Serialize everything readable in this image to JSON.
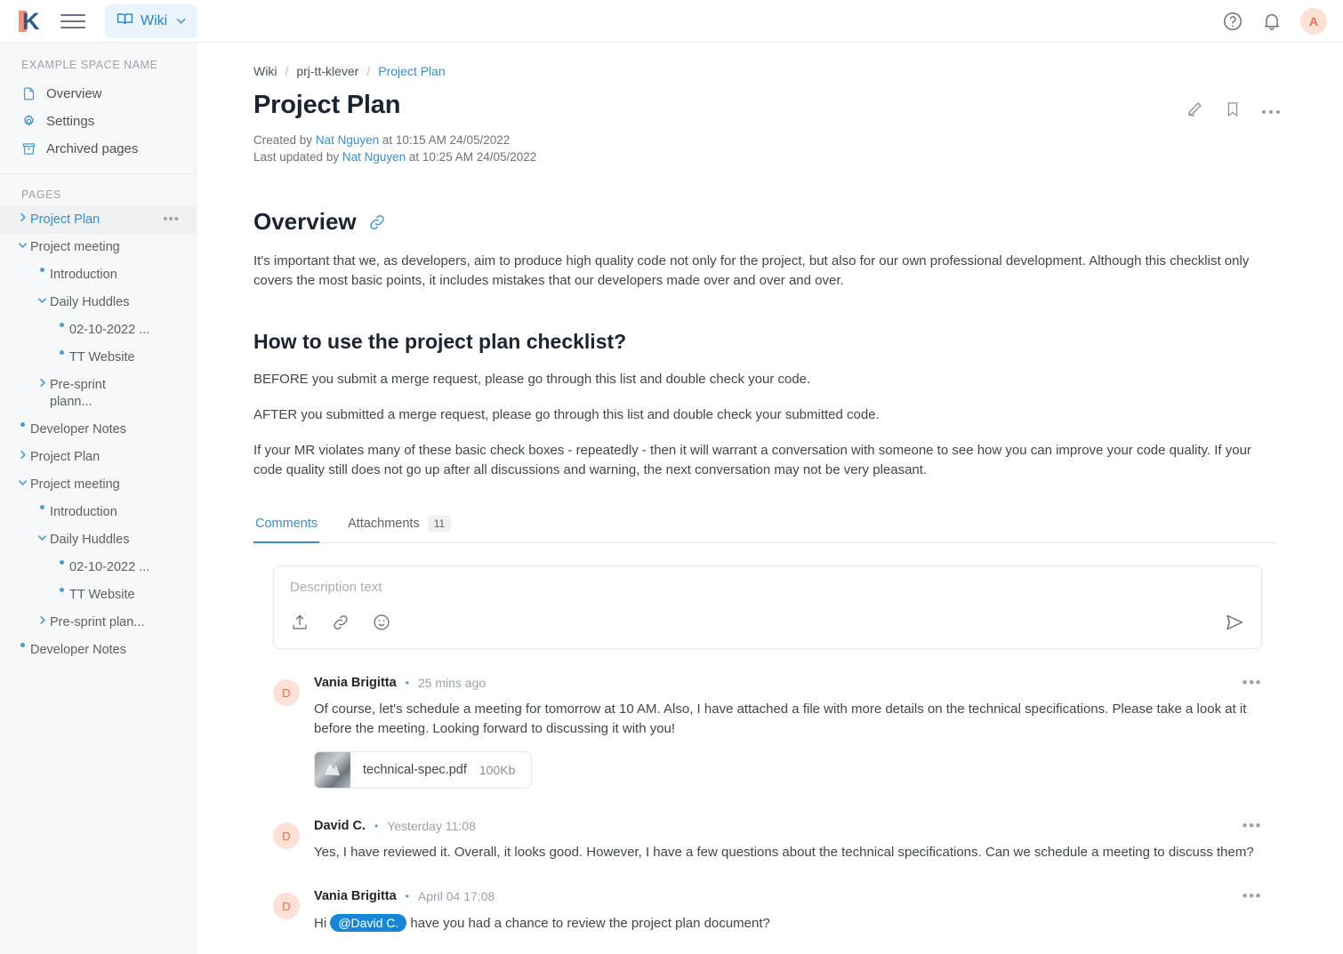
{
  "topbar": {
    "logo_alt": "klever-logo",
    "menu_label": "hamburger-menu",
    "wiki_button": "Wiki",
    "caret": "⌄",
    "help_label": "help",
    "bell_label": "notifications",
    "avatar_initial": "A"
  },
  "sidebar": {
    "space_name": "EXAMPLE SPACE NAME",
    "nav": [
      {
        "label": "Overview",
        "icon": "document-icon"
      },
      {
        "label": "Settings",
        "icon": "gear-icon"
      },
      {
        "label": "Archived pages",
        "icon": "archive-icon"
      }
    ],
    "pages_label": "PAGES",
    "tree": [
      {
        "label": "Project Plan",
        "indent": 0,
        "marker": "chevron-right",
        "active": true,
        "dots": "•••"
      },
      {
        "label": "Project meeting",
        "indent": 0,
        "marker": "chevron-down",
        "active": false
      },
      {
        "label": "Introduction",
        "indent": 1,
        "marker": "bullet",
        "active": false
      },
      {
        "label": "Daily Huddles",
        "indent": 1,
        "marker": "chevron-down",
        "active": false
      },
      {
        "label": "02-10-2022 ...",
        "indent": 2,
        "marker": "bullet",
        "active": false
      },
      {
        "label": "TT Website",
        "indent": 2,
        "marker": "bullet",
        "active": false
      },
      {
        "label": "Pre-sprint plann...",
        "indent": 1,
        "marker": "chevron-right",
        "active": false,
        "wrap": true
      },
      {
        "label": "Developer Notes",
        "indent": 0,
        "marker": "bullet",
        "active": false
      },
      {
        "label": "Project Plan",
        "indent": 0,
        "marker": "chevron-right",
        "active": false
      },
      {
        "label": "Project meeting",
        "indent": 0,
        "marker": "chevron-down",
        "active": false
      },
      {
        "label": "Introduction",
        "indent": 1,
        "marker": "bullet",
        "active": false
      },
      {
        "label": "Daily Huddles",
        "indent": 1,
        "marker": "chevron-down",
        "active": false
      },
      {
        "label": "02-10-2022 ...",
        "indent": 2,
        "marker": "bullet",
        "active": false
      },
      {
        "label": "TT Website",
        "indent": 2,
        "marker": "bullet",
        "active": false
      },
      {
        "label": "Pre-sprint plan...",
        "indent": 1,
        "marker": "chevron-right",
        "active": false
      },
      {
        "label": "Developer Notes",
        "indent": 0,
        "marker": "bullet",
        "active": false
      }
    ]
  },
  "breadcrumb": {
    "root": "Wiki",
    "sep": "/",
    "project": "prj-tt-klever",
    "current": "Project Plan"
  },
  "page": {
    "title": "Project Plan",
    "created_prefix": "Created by",
    "created_author": "Nat Nguyen",
    "created_suffix": "at 10:15 AM 24/05/2022",
    "updated_prefix": "Last updated by",
    "updated_author": "Nat Nguyen",
    "updated_suffix": "at 10:25 AM 24/05/2022",
    "actions": {
      "edit": "edit-pencil-icon",
      "bookmark": "bookmark-icon",
      "more": "more-options-icon"
    }
  },
  "content": {
    "overview_heading": "Overview",
    "overview_paragraph": "It's important that we, as developers, aim to produce high quality code not only for the project, but also for our own professional development. Although this checklist only covers the most basic points, it includes mistakes that our developers made over and over and over.",
    "howto_heading": "How to use the project plan checklist?",
    "para_before": "BEFORE you submit a merge request, please go through this list and double check your code.",
    "para_after": "AFTER you submitted a merge request, please go through this list and double check your submitted code.",
    "para_violates": "If your MR violates many of these basic check boxes - repeatedly - then it will warrant a conversation with someone to see how you can improve your code quality. If your code quality still does not go up after all discussions and warning, the next conversation may not be very pleasant."
  },
  "tabs": [
    {
      "label": "Comments",
      "active": true,
      "count": null
    },
    {
      "label": "Attachments",
      "active": false,
      "count": "11"
    }
  ],
  "composer": {
    "placeholder": "Description text",
    "value": "",
    "upload_icon": "upload-icon",
    "link_icon": "link-icon",
    "emoji_icon": "emoji-icon",
    "send_icon": "send-icon"
  },
  "comments": [
    {
      "avatar": "D",
      "author": "Vania Brigitta",
      "time": "25 mins ago",
      "text": "Of course, let's schedule a meeting for tomorrow at 10 AM. Also, I have attached a file with more details on the technical specifications. Please take a look at it before the meeting. Looking forward to discussing it with you!",
      "attachment": {
        "name": "technical-spec.pdf",
        "size": "100Kb"
      },
      "more": "•••"
    },
    {
      "avatar": "D",
      "author": "David C.",
      "time": "Yesterday 11:08",
      "text": "Yes, I have reviewed it. Overall, it looks good. However, I have a few questions about the technical specifications. Can we schedule a meeting to discuss them?",
      "attachment": null,
      "more": "•••"
    },
    {
      "avatar": "D",
      "author": "Vania Brigitta",
      "time": "April 04 17:08",
      "text_before": "Hi",
      "mention": "@David C.",
      "text_after": "have you had a chance to review the project plan document?",
      "attachment": null,
      "more": "•••"
    }
  ],
  "colors": {
    "accent_blue": "#3a8dc8",
    "logo_coral": "#f98f73",
    "logo_navy": "#2a5c86",
    "avatar_bg": "#fde0d6",
    "avatar_fg": "#e8714c",
    "mention_bg": "#1886d6",
    "sidebar_bg": "#f7f8f9"
  }
}
